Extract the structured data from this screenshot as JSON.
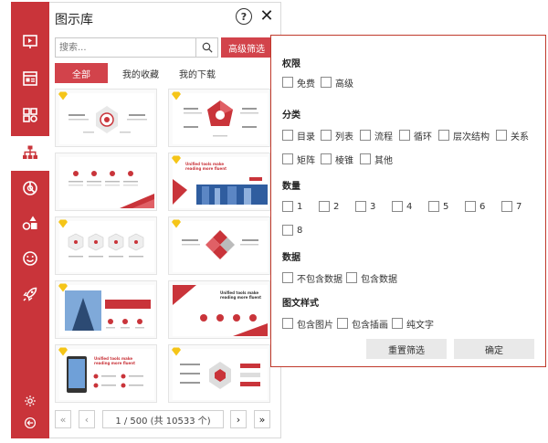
{
  "panel": {
    "title": "图示库",
    "help_icon": "help-circle-icon",
    "close_icon": "close-icon"
  },
  "search": {
    "placeholder": "搜索...",
    "value": "",
    "icon": "search-icon"
  },
  "advanced_button": {
    "label": "高级筛选"
  },
  "tabs": [
    {
      "label": "全部",
      "active": true
    },
    {
      "label": "我的收藏",
      "active": false
    },
    {
      "label": "我的下载",
      "active": false
    }
  ],
  "rail": {
    "items": [
      "presentation-icon",
      "layout-icon",
      "grid-icon",
      "org-chart-icon",
      "pie-chart-icon",
      "shapes-icon",
      "smile-icon",
      "rocket-icon"
    ],
    "active_index": 3,
    "bottom": [
      "settings-icon",
      "back-arrow-icon"
    ]
  },
  "thumbnails": {
    "texts": {
      "promo_line1": "Unified tools make",
      "promo_line2": "reading more fluent"
    }
  },
  "pager": {
    "first": "«",
    "prev": "‹",
    "info": "1 / 500 (共 10533 个)",
    "next": "›",
    "last": "»"
  },
  "filter": {
    "sections": {
      "permission": {
        "label": "权限",
        "options": [
          "免费",
          "高级"
        ]
      },
      "category": {
        "label": "分类",
        "options": [
          "目录",
          "列表",
          "流程",
          "循环",
          "层次结构",
          "关系",
          "矩阵",
          "棱锥",
          "其他"
        ]
      },
      "quantity": {
        "label": "数量",
        "options": [
          "1",
          "2",
          "3",
          "4",
          "5",
          "6",
          "7",
          "8"
        ]
      },
      "data": {
        "label": "数据",
        "options": [
          "不包含数据",
          "包含数据"
        ]
      },
      "style": {
        "label": "图文样式",
        "options": [
          "包含图片",
          "包含插画",
          "纯文字"
        ]
      }
    },
    "reset_label": "重置筛选",
    "confirm_label": "确定"
  },
  "colors": {
    "accent": "#d2434b",
    "rail": "#c9343a",
    "badge": "#f5c518"
  }
}
